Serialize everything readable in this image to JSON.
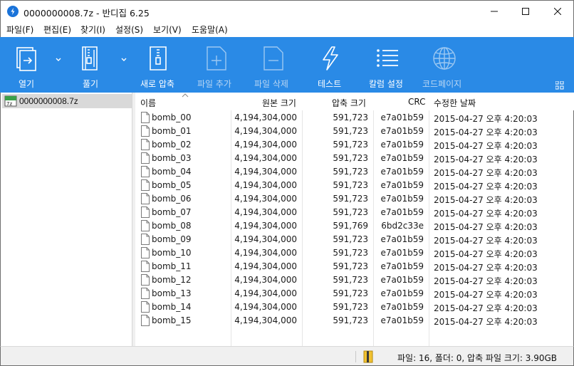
{
  "window": {
    "title": "0000000008.7z - 반디집 6.25"
  },
  "menu": [
    "파일(F)",
    "편집(E)",
    "찾기(I)",
    "설정(S)",
    "보기(V)",
    "도움말(A)"
  ],
  "toolbar": {
    "open_label": "열기",
    "extract_label": "풀기",
    "new_archive_label": "새로 압축",
    "add_files_label": "파일 추가",
    "delete_files_label": "파일 삭제",
    "test_label": "테스트",
    "columns_label": "칼럼 설정",
    "codepage_label": "코드페이지"
  },
  "tree": {
    "root_label": "0000000008.7z"
  },
  "table": {
    "headers": {
      "name": "이름",
      "original_size": "원본 크기",
      "compressed_size": "압축 크기",
      "crc": "CRC",
      "modified": "수정한 날짜"
    },
    "rows": [
      {
        "name": "bomb_00",
        "size": "4,194,304,000",
        "packed": "591,723",
        "crc": "e7a01b59",
        "date": "2015-04-27 오후 4:20:03"
      },
      {
        "name": "bomb_01",
        "size": "4,194,304,000",
        "packed": "591,723",
        "crc": "e7a01b59",
        "date": "2015-04-27 오후 4:20:03"
      },
      {
        "name": "bomb_02",
        "size": "4,194,304,000",
        "packed": "591,723",
        "crc": "e7a01b59",
        "date": "2015-04-27 오후 4:20:03"
      },
      {
        "name": "bomb_03",
        "size": "4,194,304,000",
        "packed": "591,723",
        "crc": "e7a01b59",
        "date": "2015-04-27 오후 4:20:03"
      },
      {
        "name": "bomb_04",
        "size": "4,194,304,000",
        "packed": "591,723",
        "crc": "e7a01b59",
        "date": "2015-04-27 오후 4:20:03"
      },
      {
        "name": "bomb_05",
        "size": "4,194,304,000",
        "packed": "591,723",
        "crc": "e7a01b59",
        "date": "2015-04-27 오후 4:20:03"
      },
      {
        "name": "bomb_06",
        "size": "4,194,304,000",
        "packed": "591,723",
        "crc": "e7a01b59",
        "date": "2015-04-27 오후 4:20:03"
      },
      {
        "name": "bomb_07",
        "size": "4,194,304,000",
        "packed": "591,723",
        "crc": "e7a01b59",
        "date": "2015-04-27 오후 4:20:03"
      },
      {
        "name": "bomb_08",
        "size": "4,194,304,000",
        "packed": "591,769",
        "crc": "6bd2c33e",
        "date": "2015-04-27 오후 4:20:03"
      },
      {
        "name": "bomb_09",
        "size": "4,194,304,000",
        "packed": "591,723",
        "crc": "e7a01b59",
        "date": "2015-04-27 오후 4:20:03"
      },
      {
        "name": "bomb_10",
        "size": "4,194,304,000",
        "packed": "591,723",
        "crc": "e7a01b59",
        "date": "2015-04-27 오후 4:20:03"
      },
      {
        "name": "bomb_11",
        "size": "4,194,304,000",
        "packed": "591,723",
        "crc": "e7a01b59",
        "date": "2015-04-27 오후 4:20:03"
      },
      {
        "name": "bomb_12",
        "size": "4,194,304,000",
        "packed": "591,723",
        "crc": "e7a01b59",
        "date": "2015-04-27 오후 4:20:03"
      },
      {
        "name": "bomb_13",
        "size": "4,194,304,000",
        "packed": "591,723",
        "crc": "e7a01b59",
        "date": "2015-04-27 오후 4:20:03"
      },
      {
        "name": "bomb_14",
        "size": "4,194,304,000",
        "packed": "591,723",
        "crc": "e7a01b59",
        "date": "2015-04-27 오후 4:20:03"
      },
      {
        "name": "bomb_15",
        "size": "4,194,304,000",
        "packed": "591,723",
        "crc": "e7a01b59",
        "date": "2015-04-27 오후 4:20:03"
      }
    ]
  },
  "status": {
    "summary": "파일: 16, 폴더: 0, 압축 파일 크기: 3.90GB"
  },
  "colors": {
    "toolbar_bg": "#2a8ae6",
    "selection_bg": "#d9d9d9",
    "app_icon": "#1a73d9"
  },
  "icons": {
    "app": "bandizip-logo-icon",
    "open": "open-archive-icon",
    "extract": "extract-zipper-icon",
    "new_archive": "new-archive-zipper-icon",
    "add": "add-file-icon",
    "delete": "delete-file-icon",
    "test": "lightning-test-icon",
    "columns": "columns-list-icon",
    "codepage": "globe-icon"
  }
}
